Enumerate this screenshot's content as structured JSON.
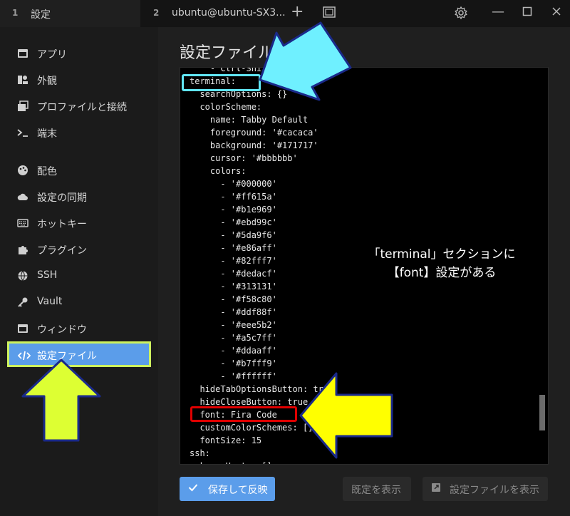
{
  "titlebar": {
    "tabs": [
      {
        "number": "1",
        "title": "設定"
      },
      {
        "number": "2",
        "title": "ubuntu@ubuntu-SX3..."
      }
    ],
    "icons": [
      "plus-icon",
      "window-icon",
      "gear-icon",
      "minimize-icon",
      "maximize-icon",
      "close-icon"
    ]
  },
  "sidebar": {
    "items": [
      {
        "label": "アプリ",
        "icon": "app-window-icon"
      },
      {
        "label": "外観",
        "icon": "appearance-icon"
      },
      {
        "label": "プロファイルと接続",
        "icon": "profiles-icon"
      },
      {
        "label": "端末",
        "icon": "terminal-prompt-icon"
      },
      {
        "label": "配色",
        "icon": "palette-icon"
      },
      {
        "label": "設定の同期",
        "icon": "cloud-icon"
      },
      {
        "label": "ホットキー",
        "icon": "keyboard-icon"
      },
      {
        "label": "プラグイン",
        "icon": "puzzle-icon"
      },
      {
        "label": "SSH",
        "icon": "globe-icon"
      },
      {
        "label": "Vault",
        "icon": "key-icon"
      },
      {
        "label": "ウィンドウ",
        "icon": "window-icon"
      },
      {
        "label": "設定ファイル",
        "icon": "code-icon",
        "active": true
      }
    ]
  },
  "main": {
    "heading": "設定ファイル",
    "code_lines": [
      "    - Ctrl-Shift",
      "terminal:",
      "  searchOptions: {}",
      "  colorScheme:",
      "    name: Tabby Default",
      "    foreground: '#cacaca'",
      "    background: '#171717'",
      "    cursor: '#bbbbbb'",
      "    colors:",
      "      - '#000000'",
      "      - '#ff615a'",
      "      - '#b1e969'",
      "      - '#ebd99c'",
      "      - '#5da9f6'",
      "      - '#e86aff'",
      "      - '#82fff7'",
      "      - '#dedacf'",
      "      - '#313131'",
      "      - '#f58c80'",
      "      - '#ddf88f'",
      "      - '#eee5b2'",
      "      - '#a5c7ff'",
      "      - '#ddaaff'",
      "      - '#b7fff9'",
      "      - '#ffffff'",
      "  hideTabOptionsButton: true",
      "  hideCloseButton: true",
      "  font: Fira Code",
      "  customColorSchemes: []",
      "  fontSize: 15",
      "ssh:",
      "  knownHosts: []"
    ],
    "annotation_line1": "「terminal」セクションに",
    "annotation_line2": "【font】設定がある"
  },
  "footer": {
    "save_label": "保存して反映",
    "show_defaults_label": "既定を表示",
    "show_file_label": "設定ファイルを表示"
  },
  "colors": {
    "accent": "#5b9dea",
    "highlight_cyan": "#61e6f4",
    "highlight_red": "#e00000",
    "arrow_yellow": "#ffff00",
    "arrow_lime": "#ddff33"
  }
}
